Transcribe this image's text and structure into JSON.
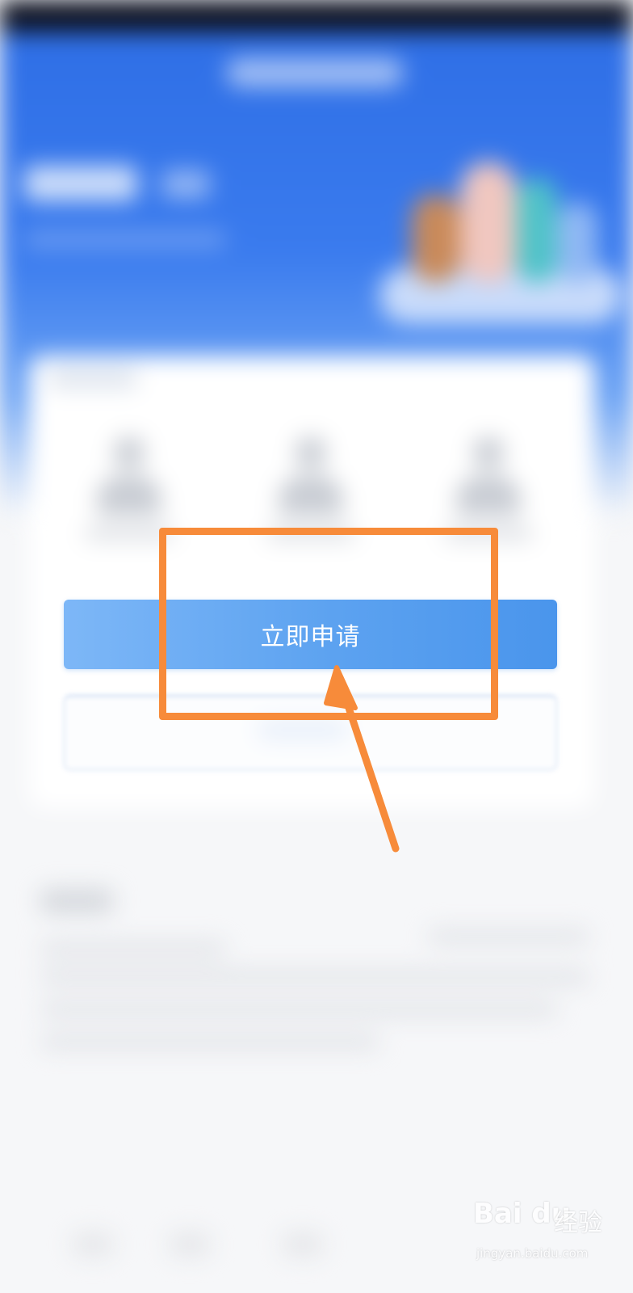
{
  "main": {
    "apply_button_label": "立即申请"
  },
  "annotation": {
    "highlight_color": "#f78b3a",
    "arrow_color": "#f78b3a"
  },
  "watermark": {
    "logo_text": "Bai du",
    "jingyan_text": "经验",
    "url_text": "jingyan.baidu.com"
  },
  "colors": {
    "hero_blue": "#2f6fe6",
    "button_blue": "#5ca2f0",
    "page_background": "#f6f7f9"
  }
}
